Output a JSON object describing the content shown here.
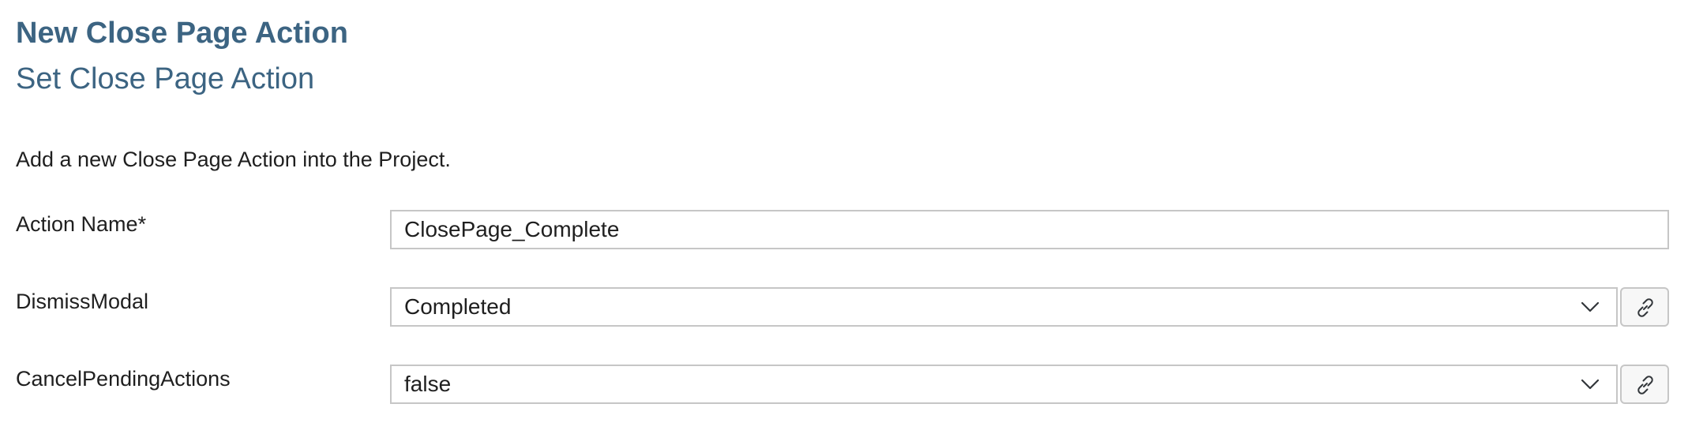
{
  "header": {
    "title": "New Close Page Action",
    "subtitle": "Set Close Page Action"
  },
  "description": "Add a new Close Page Action into the Project.",
  "form": {
    "action_name": {
      "label": "Action Name*",
      "value": "ClosePage_Complete"
    },
    "dismiss_modal": {
      "label": "DismissModal",
      "value": "Completed",
      "icon": "chevron-down-icon",
      "link_icon": "link-icon"
    },
    "cancel_pending_actions": {
      "label": "CancelPendingActions",
      "value": "false",
      "icon": "chevron-down-icon",
      "link_icon": "link-icon"
    }
  },
  "colors": {
    "title": "#3c6482",
    "text": "#1f1f1f",
    "border": "#c6c6c6",
    "icon": "#32363a"
  }
}
